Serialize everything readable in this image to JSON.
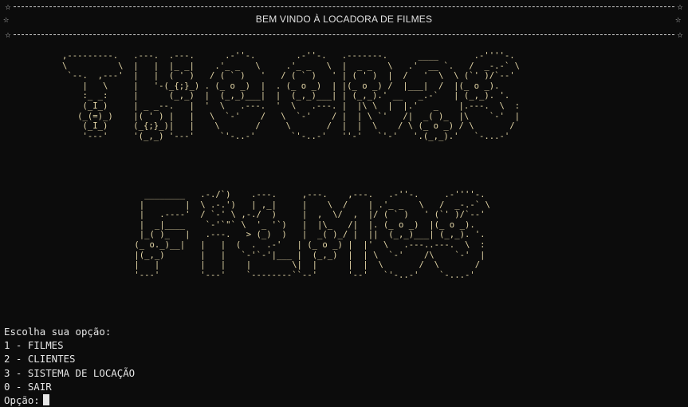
{
  "banner": {
    "star": "☆",
    "title": "BEM VINDO À LOCADORA DE FILMES"
  },
  "art": {
    "line1": ",---------.   .---.  .---.      .-''-.        .-''-.   .-------.      ____       .-''''-.\n\\          \\  |   |  |_ _|    .'_ _   \\     .'_ _   \\  |  _ _   \\   .'  __ `.   /  _-.-` \\\n `--.  ,---'  |   |  ( ' )   / ( ` )   '   / ( ` )   ' | ( ' )  |  /   '  \\  \\ (`' )/`--'\n    |   \\     |   '-(_{;}_) . (_ o _)  |  . (_ o _)  | |(_ o _) /  |___|  /  |(_ o _).\n    :_ _:     |      (_,_)  |  (_,_)___|  |  (_,_)___| | (_,_).' __   _.-`   | (_,_). '.\n    (_I_)     | _ _--.   |  '  \\   .---.  '  \\   .---. |  |\\ \\  |  |.'   _    |.---.  \\  :\n   (_(=)_)    |( ' ) |   |   \\  `-'    /   \\  `-'    / |  | \\ `'   /|  _( )_  |\\    `-'  |\n    (_I_)     (_{;}_)|   |    \\       /     \\       /  |  |  \\    / \\ (_ o _) / \\       /\n    '---'     '(_,_) '---'     `'-..-'       `'-..-'   ''-'   `'-'   '.(_,_).'   `-...-'",
    "line2": "   ________   .-./`)    .---.     ,---.    ,---.   .-''-.     .-''''-.\n  |        |  \\ .-.')   | ,_|     |    \\  /    | .'_ _   \\   /  _-.-` \\\n  |   .----'  / `-' \\ ,-./  )     |  ,  \\/  ,  |/ ( ` )   ' (`' )/`--'\n  |  _|____    `-'`\"` \\  '_ '`)   |  |\\_   /|  |. (_ o _)  |(_ o _).\n  |_( )_   |   .---.   > (_)  )   |  _( )_/ |  ||  (_,_)___| (_,_). '.\n (_ o._)__|   |   |  (  .  .-'   | (_ o _) |  |'  \\   .---..---.  \\  :\n |(_,_)       |   |   `-'`-'|___ |  (_,_)  |  | \\  `-'    /\\    `-'  |\n |   |        |   |    |        \\|  |      |  |  \\       /  \\       /\n '---'        '---'    `--------``--'      '--'   `'-..-'    `-...-'"
  },
  "menu": {
    "prompt_title": "Escolha sua opção:",
    "opt1": "1 - FILMES",
    "opt2": "2 - CLIENTES",
    "opt3": "3 - SISTEMA DE LOCAÇÃO",
    "opt0": "0 - SAIR",
    "input_label": "Opção:"
  },
  "colors": {
    "background": "#0c0c0c",
    "text": "#cccccc",
    "art": "#e5d7a8"
  }
}
